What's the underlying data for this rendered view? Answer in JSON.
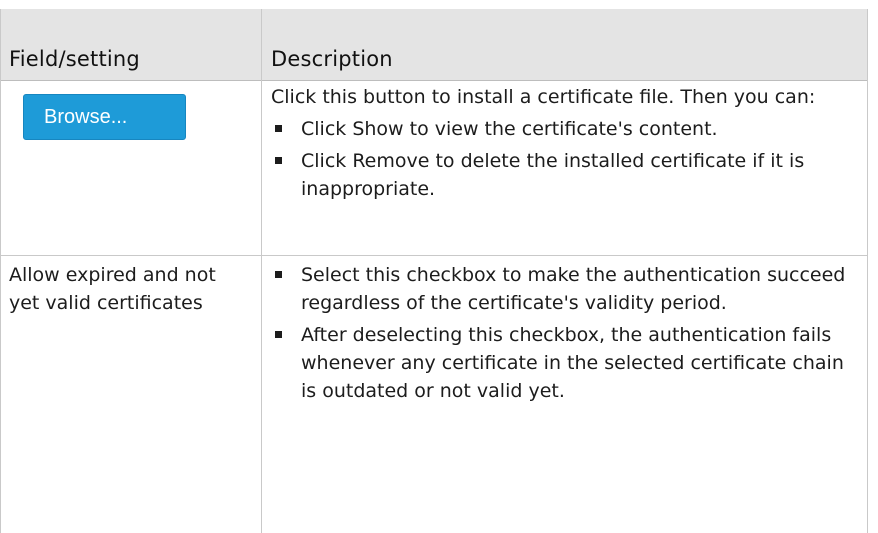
{
  "table": {
    "header": {
      "field": "Field/setting",
      "description": "Description"
    },
    "rows": [
      {
        "field_button": "Browse...",
        "description_text": "Click this button to install a certificate file. Then you can:",
        "bullets": [
          "Click Show to view the certificate's content.",
          "Click Remove to delete the installed certificate if it is inappropriate."
        ]
      },
      {
        "field": "Allow expired and not yet valid certificates",
        "bullets": [
          "Select this checkbox to make the authentication succeed regardless of the certificate's validity period.",
          "After deselecting this checkbox, the authentication fails whenever any certificate in the selected certificate chain is outdated or not valid yet."
        ]
      }
    ]
  },
  "colors": {
    "header_bg": "#e4e4e4",
    "button_bg": "#1e9bd8",
    "border": "#c9c9c9",
    "text": "#1c1c1c"
  }
}
